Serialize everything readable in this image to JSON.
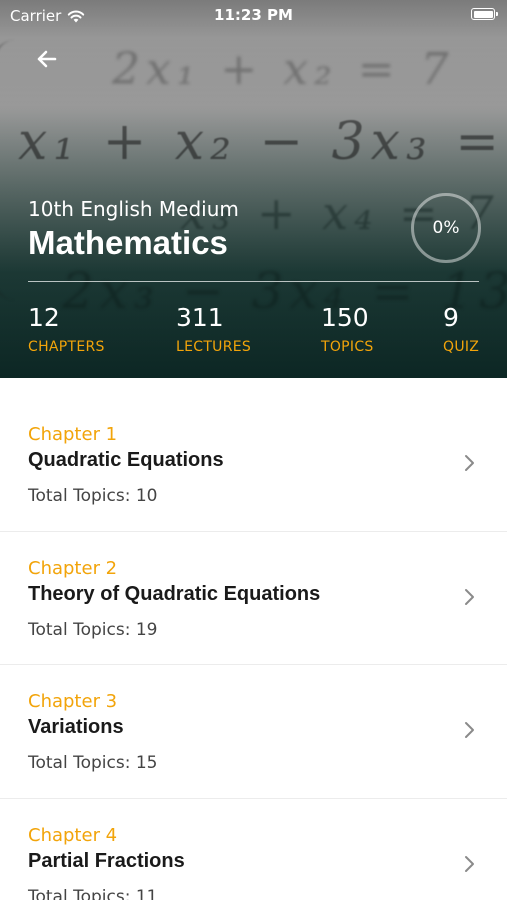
{
  "status_bar": {
    "carrier": "Carrier",
    "time": "11:23 PM"
  },
  "header": {
    "subtitle": "10th English Medium",
    "title": "Mathematics",
    "progress": "0%",
    "progress_value": 0,
    "accent_color": "#f2a40a",
    "stats": [
      {
        "value": "12",
        "label": "CHAPTERS"
      },
      {
        "value": "311",
        "label": "LECTURES"
      },
      {
        "value": "150",
        "label": "TOPICS"
      },
      {
        "value": "9",
        "label": "QUIZ"
      }
    ]
  },
  "chapters": [
    {
      "number": "Chapter 1",
      "title": "Quadratic Equations",
      "topics": "Total Topics: 10"
    },
    {
      "number": "Chapter 2",
      "title": "Theory of Quadratic Equations",
      "topics": "Total Topics: 19"
    },
    {
      "number": "Chapter 3",
      "title": "Variations",
      "topics": "Total Topics: 15"
    },
    {
      "number": "Chapter 4",
      "title": "Partial Fractions",
      "topics": "Total Topics: 11"
    }
  ],
  "icons": {
    "back": "arrow-left-icon",
    "chevron": "chevron-right-icon",
    "wifi": "wifi-icon",
    "battery": "battery-icon"
  }
}
